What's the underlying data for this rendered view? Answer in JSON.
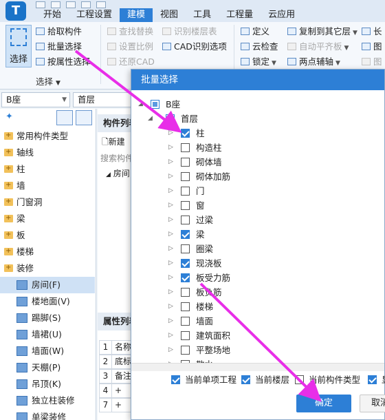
{
  "app": {
    "logo_letter": "T"
  },
  "menu": {
    "tabs": [
      "开始",
      "工程设置",
      "建模",
      "视图",
      "工具",
      "工程量",
      "云应用"
    ],
    "active_index": 2
  },
  "ribbon": {
    "select_label": "选择",
    "pick_component": "拾取构件",
    "batch_select": "批量选择",
    "select_by_attr": "按属性选择",
    "group_label": "选择",
    "find_replace": "查找替换",
    "set_scale": "设置比例",
    "restore_cad": "还原CAD",
    "identify_floor_table": "识别楼层表",
    "cad_identify_options": "CAD识别选项",
    "define": "定义",
    "cloud_check": "云检查",
    "lock": "锁定",
    "copy_to_other_floor": "复制到其它层",
    "auto_flat_slab": "自动平齐板",
    "two_point_axis": "两点辅轴",
    "long": "长",
    "pic": "图",
    "pic2": "图"
  },
  "left": {
    "building_select": "B座",
    "floor_select": "首层",
    "tree": [
      {
        "label": "常用构件类型"
      },
      {
        "label": "轴线"
      },
      {
        "label": "柱"
      },
      {
        "label": "墙"
      },
      {
        "label": "门窗洞"
      },
      {
        "label": "梁"
      },
      {
        "label": "板"
      },
      {
        "label": "楼梯"
      },
      {
        "label": "装修"
      }
    ],
    "sub_items": [
      {
        "label": "房间(F)"
      },
      {
        "label": "楼地面(V)"
      },
      {
        "label": "踢脚(S)"
      },
      {
        "label": "墙裙(U)"
      },
      {
        "label": "墙面(W)"
      },
      {
        "label": "天棚(P)"
      },
      {
        "label": "吊顶(K)"
      },
      {
        "label": "独立柱装修"
      },
      {
        "label": "单梁装修"
      }
    ]
  },
  "middle": {
    "component_list_header": "构件列表",
    "new_button": "新建",
    "search_placeholder": "搜索构件",
    "room_item": "房间",
    "attr_list_header": "属性列表",
    "attr_rows": [
      {
        "num": "1",
        "text": "名称"
      },
      {
        "num": "2",
        "text": "底标"
      },
      {
        "num": "3",
        "text": "备注"
      },
      {
        "num": "4",
        "text": "+"
      },
      {
        "num": "7",
        "text": "+"
      }
    ]
  },
  "dialog": {
    "title": "批量选择",
    "root": "B座",
    "floor": "首层",
    "items": [
      {
        "label": "柱",
        "checked": true
      },
      {
        "label": "构造柱",
        "checked": false
      },
      {
        "label": "砌体墙",
        "checked": false
      },
      {
        "label": "砌体加筋",
        "checked": false
      },
      {
        "label": "门",
        "checked": false
      },
      {
        "label": "窗",
        "checked": false
      },
      {
        "label": "过梁",
        "checked": false
      },
      {
        "label": "梁",
        "checked": true
      },
      {
        "label": "圈梁",
        "checked": false
      },
      {
        "label": "现浇板",
        "checked": true
      },
      {
        "label": "板受力筋",
        "checked": true
      },
      {
        "label": "板负筋",
        "checked": false
      },
      {
        "label": "楼梯",
        "checked": false
      },
      {
        "label": "墙面",
        "checked": false
      },
      {
        "label": "建筑面积",
        "checked": false
      },
      {
        "label": "平整场地",
        "checked": false
      },
      {
        "label": "散水",
        "checked": false
      }
    ],
    "options": [
      {
        "label": "当前单项工程",
        "checked": true
      },
      {
        "label": "当前楼层",
        "checked": true
      },
      {
        "label": "当前构件类型",
        "checked": false
      },
      {
        "label": "显",
        "checked": true
      }
    ],
    "ok": "确定",
    "cancel": "取消"
  },
  "colors": {
    "accent": "#2d7fd6",
    "annotation": "#e82ee8"
  }
}
